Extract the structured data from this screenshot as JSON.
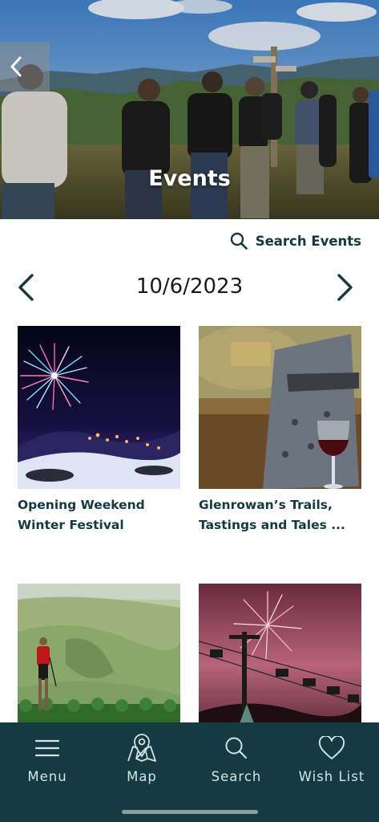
{
  "hero": {
    "title": "Events",
    "back_icon": "chevron-left-icon"
  },
  "search": {
    "label": "Search Events",
    "icon": "search-icon"
  },
  "date_nav": {
    "date": "10/6/2023",
    "prev_icon": "chevron-left-icon",
    "next_icon": "chevron-right-icon"
  },
  "events": [
    {
      "title": "Opening Weekend Winter Festival"
    },
    {
      "title": "Glenrowan’s Trails, Tastings and Tales ..."
    },
    {
      "title": ""
    },
    {
      "title": ""
    }
  ],
  "bottom_nav": {
    "items": [
      {
        "label": "Menu",
        "icon": "menu-icon"
      },
      {
        "label": "Map",
        "icon": "map-icon"
      },
      {
        "label": "Search",
        "icon": "search-icon"
      },
      {
        "label": "Wish List",
        "icon": "heart-icon"
      }
    ]
  },
  "colors": {
    "primary_dark": "#163a41",
    "nav_text": "#cfe6e4",
    "title_text": "#123a40"
  }
}
